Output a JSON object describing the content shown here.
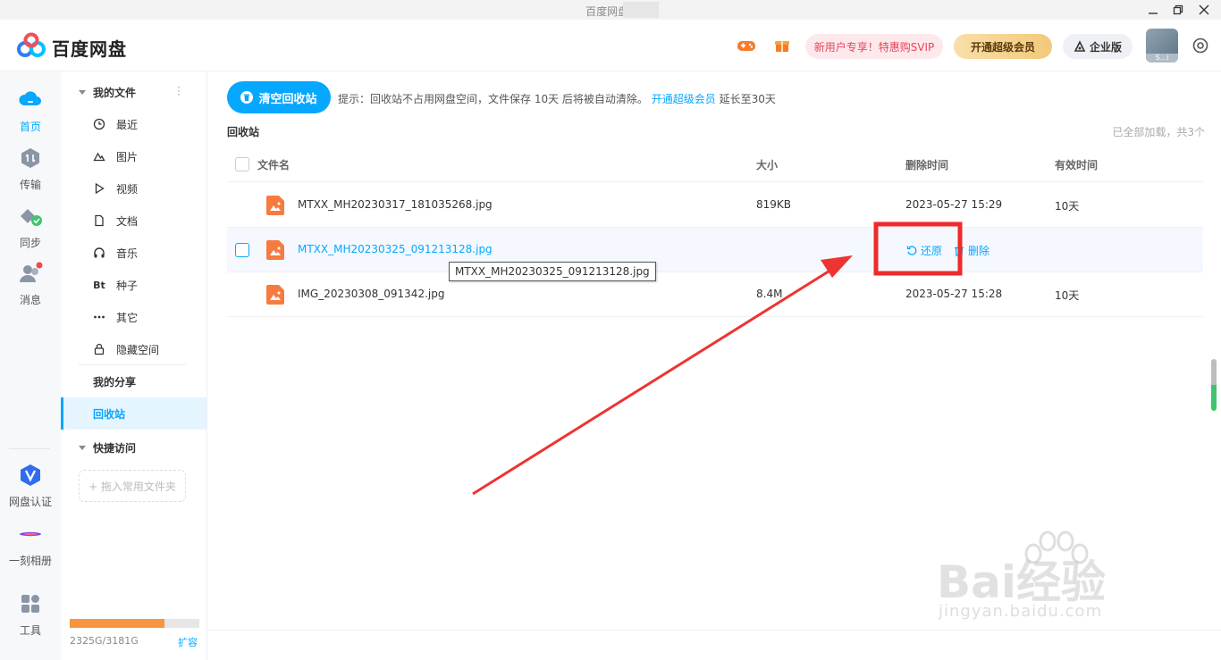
{
  "window": {
    "title": "百度网盘 ·"
  },
  "header": {
    "brand": "百度网盘",
    "promo_label": "新用户专享！特惠购SVIP",
    "vip_label": "开通超级会员",
    "enterprise_label": "企业版",
    "avatar_tag": "S...i"
  },
  "rail": {
    "items": [
      {
        "label": "首页"
      },
      {
        "label": "传输"
      },
      {
        "label": "同步"
      },
      {
        "label": "消息"
      },
      {
        "label": "网盘认证"
      },
      {
        "label": "一刻相册"
      },
      {
        "label": "工具"
      }
    ],
    "colors": {
      "accent": "#06a7ff"
    }
  },
  "nav": {
    "my_files": "我的文件",
    "items": [
      {
        "label": "最近",
        "icon": "clock-icon"
      },
      {
        "label": "图片",
        "icon": "image-icon"
      },
      {
        "label": "视频",
        "icon": "play-icon"
      },
      {
        "label": "文档",
        "icon": "document-icon"
      },
      {
        "label": "音乐",
        "icon": "headphones-icon"
      },
      {
        "label": "种子",
        "icon": "bt-icon",
        "glyph": "Bt"
      },
      {
        "label": "其它",
        "icon": "more-icon"
      },
      {
        "label": "隐藏空间",
        "icon": "lock-icon"
      }
    ],
    "my_share": "我的分享",
    "recycle_bin": "回收站",
    "quick_access": "快捷访问",
    "drop_hint": "+ 拖入常用文件夹",
    "storage": {
      "used_text": "2325G/3181G",
      "used_fraction": 0.731,
      "expand_label": "扩容"
    }
  },
  "main": {
    "clear_button": "清空回收站",
    "tip_prefix": "提示：回收站不占用网盘空间，文件保存 10天 后将被自动清除。",
    "tip_link": "开通超级会员",
    "tip_suffix": " 延长至30天",
    "section_title": "回收站",
    "loaded_note": "已全部加载，共3个",
    "columns": {
      "name": "文件名",
      "size": "大小",
      "deleted": "删除时间",
      "valid": "有效时间"
    },
    "rows": [
      {
        "name": "MTXX_MH20230317_181035268.jpg",
        "size": "819KB",
        "deleted": "2023-05-27 15:29",
        "valid": "10天"
      },
      {
        "name": "MTXX_MH20230325_091213128.jpg",
        "restore": "还原",
        "delete": "删除"
      },
      {
        "name": "IMG_20230308_091342.jpg",
        "size": "8.4M",
        "deleted": "2023-05-27 15:28",
        "valid": "10天"
      }
    ],
    "tooltip": "MTXX_MH20230325_091213128.jpg"
  },
  "watermark": {
    "big": "Bai经验",
    "small": "jingyan.baidu.com"
  }
}
